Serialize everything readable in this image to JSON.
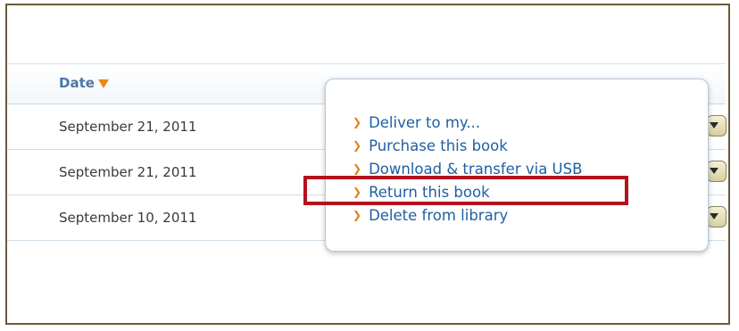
{
  "table": {
    "header": {
      "date_label": "Date"
    },
    "rows": [
      {
        "date": "September 21, 2011"
      },
      {
        "date": "September 21, 2011"
      },
      {
        "date": "September 10, 2011"
      }
    ]
  },
  "popup_menu": {
    "items": [
      {
        "label": "Deliver to my..."
      },
      {
        "label": "Purchase this book"
      },
      {
        "label": "Download & transfer via USB"
      },
      {
        "label": "Return this book"
      },
      {
        "label": "Delete from library"
      }
    ],
    "highlighted_item": "Return this book"
  },
  "colors": {
    "frame_border": "#6b5c38",
    "header_text": "#4a77a8",
    "sort_arrow": "#e8891c",
    "menu_link": "#1f5fa3",
    "menu_chevron": "#e0801c",
    "highlight": "#b4121d"
  },
  "icons": {
    "sort": "sort-descending-icon",
    "chevron": "chevron-right-icon",
    "row_action": "dropdown-arrow-icon"
  }
}
